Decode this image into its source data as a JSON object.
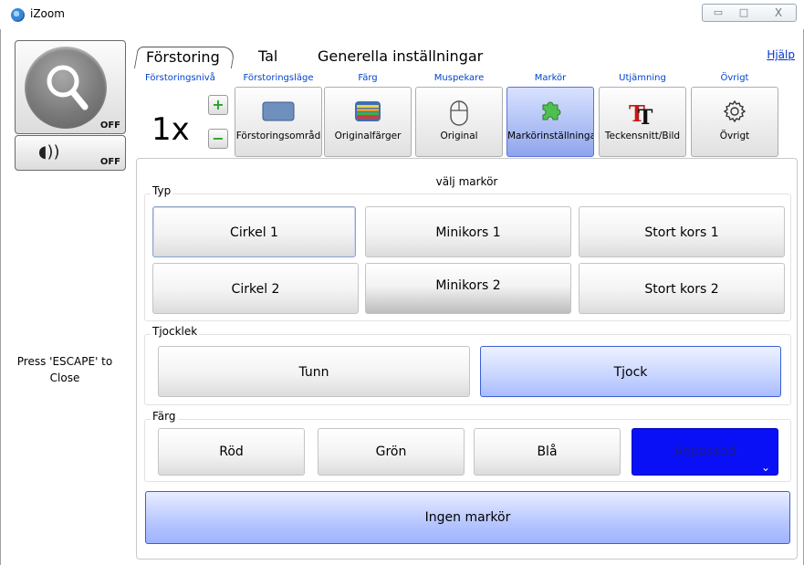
{
  "window": {
    "title": "iZoom",
    "controls": {
      "minimize": "▭",
      "maximize": "□",
      "close": "X"
    }
  },
  "left_panel": {
    "magnifier_state": "OFF",
    "speech_state": "OFF",
    "escape_hint": "Press 'ESCAPE' to Close"
  },
  "tabs": [
    {
      "label": "Förstoring",
      "active": true
    },
    {
      "label": "Tal",
      "active": false
    },
    {
      "label": "Generella inställningar",
      "active": false
    }
  ],
  "help_link": "Hjälp",
  "toolbar": {
    "level": {
      "caption": "Förstoringsnivå",
      "value": "1x",
      "plus": "+",
      "minus": "−"
    },
    "items": [
      {
        "caption": "Förstoringsläge",
        "label": "Förstoringsområd",
        "icon": "window-area-icon"
      },
      {
        "caption": "Färg",
        "label": "Originalfärger",
        "icon": "color-stripes-icon"
      },
      {
        "caption": "Muspekare",
        "label": "Original",
        "icon": "mouse-icon"
      },
      {
        "caption": "Markör",
        "label": "Markörinställninga",
        "icon": "puzzle-icon",
        "active": true
      },
      {
        "caption": "Utjämning",
        "label": "Teckensnitt/Bild",
        "icon": "font-tt-icon"
      },
      {
        "caption": "Övrigt",
        "label": "Övrigt",
        "icon": "gear-icon"
      }
    ]
  },
  "content": {
    "title": "välj markör",
    "type_group": {
      "label": "Typ",
      "options": [
        "Cirkel 1",
        "Minikors 1",
        "Stort kors 1",
        "Cirkel 2",
        "Minikors 2",
        "Stort kors 2"
      ]
    },
    "thickness_group": {
      "label": "Tjocklek",
      "options": [
        "Tunn",
        "Tjock"
      ]
    },
    "color_group": {
      "label": "Färg",
      "options": [
        "Röd",
        "Grön",
        "Blå",
        "Anpassad"
      ],
      "custom_color": "#0a10f5"
    },
    "no_cursor": "Ingen markör"
  }
}
